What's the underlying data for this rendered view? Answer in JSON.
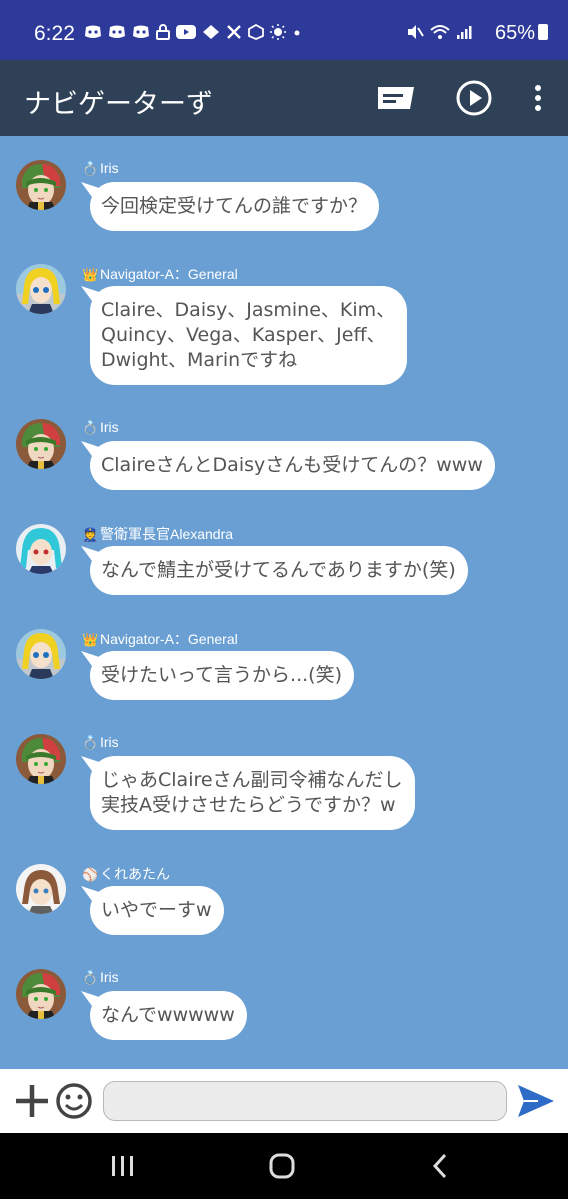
{
  "status_bar": {
    "time": "6:22",
    "left_icons": [
      "discord-icon",
      "discord-icon",
      "discord-icon",
      "lock-icon",
      "youtube-icon",
      "app-icon",
      "x-icon",
      "box-icon",
      "sun-icon",
      "dot-icon"
    ],
    "battery": "65%",
    "background": "#2e3a9a"
  },
  "app_bar": {
    "title": "ナビゲーターず",
    "background": "#2e4156"
  },
  "chat": {
    "background": "#6a9fd3",
    "messages": [
      {
        "sender": "Iris",
        "badge": "ring-icon",
        "text": "今回検定受けてんの誰ですか？"
      },
      {
        "sender": "Navigator-A：General",
        "badge": "crown-icon",
        "text": "Claire、Daisy、Jasmine、Kim、\nQuincy、Vega、Kasper、Jeff、\nDwight、Marinですね"
      },
      {
        "sender": "Iris",
        "badge": "ring-icon",
        "text": "ClaireさんとDaisyさんも受けてんの？www"
      },
      {
        "sender": "警衛軍長官Alexandra",
        "badge": "police-icon",
        "text": "なんで鯖主が受けてるんでありますか(笑)"
      },
      {
        "sender": "Navigator-A：General",
        "badge": "crown-icon",
        "text": "受けたいって言うから...(笑)"
      },
      {
        "sender": "Iris",
        "badge": "ring-icon",
        "text": "じゃあClaireさん副司令補なんだし\n実技A受けさせたらどうですか？w"
      },
      {
        "sender": "くれあたん",
        "badge": "baseball-icon",
        "text": "いやでーすw"
      },
      {
        "sender": "Iris",
        "badge": "ring-icon",
        "text": "なんでwwwww"
      }
    ]
  },
  "input_bar": {
    "placeholder": "",
    "value": ""
  },
  "colors": {
    "send": "#2f6cc8",
    "bubble": "#ffffff",
    "bubble_text": "#555555"
  }
}
